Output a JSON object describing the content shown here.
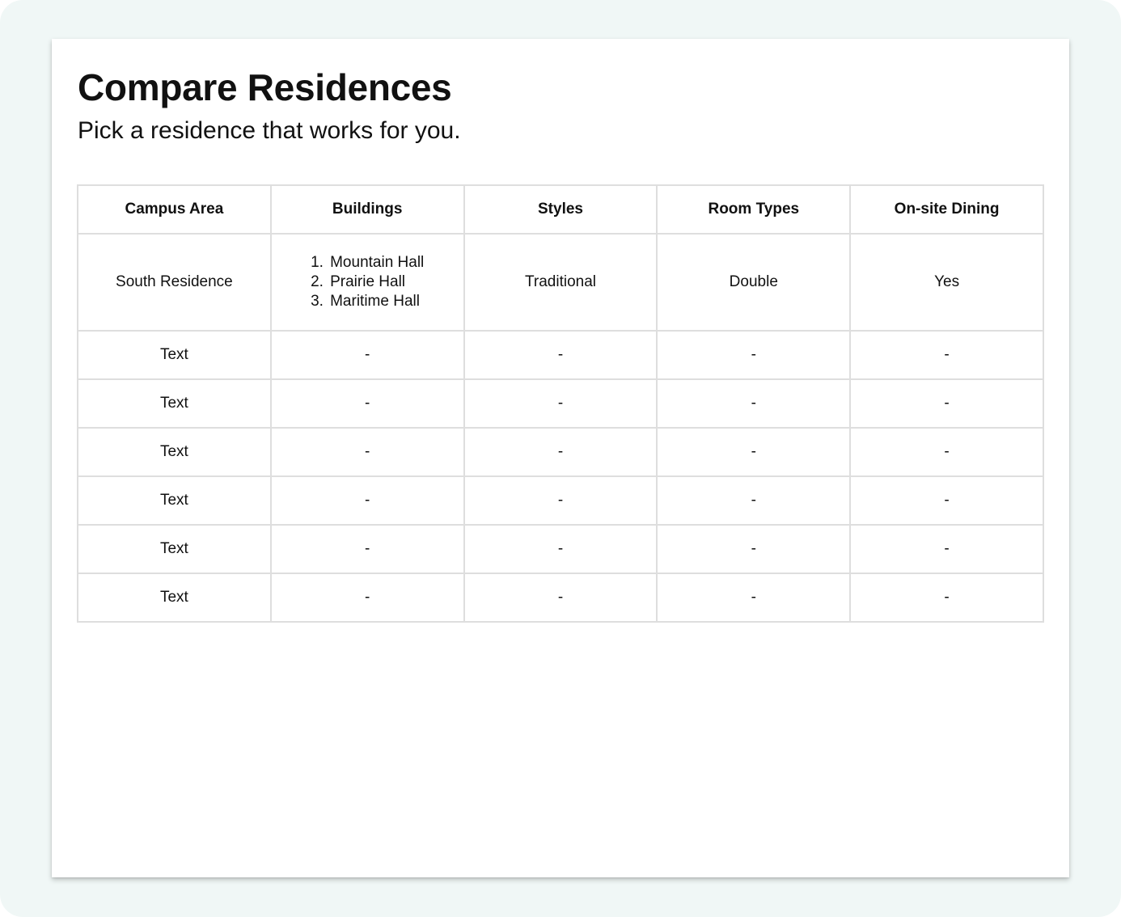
{
  "page": {
    "title": "Compare Residences",
    "subtitle": "Pick a residence that works for you."
  },
  "table": {
    "headers": [
      "Campus Area",
      "Buildings",
      "Styles",
      "Room Types",
      "On-site Dining"
    ],
    "featured_row": {
      "campus_area": "South Residence",
      "buildings": [
        {
          "number": "1.",
          "name": "Mountain Hall"
        },
        {
          "number": "2.",
          "name": "Prairie Hall"
        },
        {
          "number": "3.",
          "name": "Maritime Hall"
        }
      ],
      "style": "Traditional",
      "room_type": "Double",
      "dining": "Yes"
    },
    "rows": [
      {
        "campus_area": "Text",
        "buildings": "-",
        "style": "-",
        "room_type": "-",
        "dining": "-"
      },
      {
        "campus_area": "Text",
        "buildings": "-",
        "style": "-",
        "room_type": "-",
        "dining": "-"
      },
      {
        "campus_area": "Text",
        "buildings": "-",
        "style": "-",
        "room_type": "-",
        "dining": "-"
      },
      {
        "campus_area": "Text",
        "buildings": "-",
        "style": "-",
        "room_type": "-",
        "dining": "-"
      },
      {
        "campus_area": "Text",
        "buildings": "-",
        "style": "-",
        "room_type": "-",
        "dining": "-"
      },
      {
        "campus_area": "Text",
        "buildings": "-",
        "style": "-",
        "room_type": "-",
        "dining": "-"
      }
    ]
  },
  "colors": {
    "backdrop": "#f0f7f6",
    "card": "#ffffff",
    "border": "#dedede",
    "text": "#111111"
  }
}
